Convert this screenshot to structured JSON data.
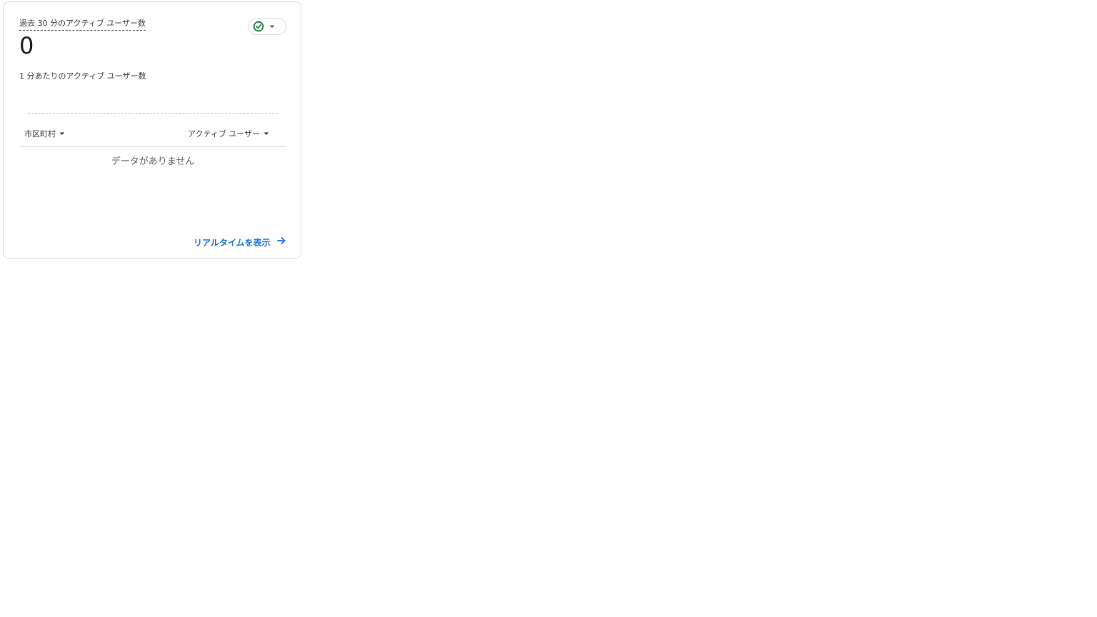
{
  "card": {
    "title": "過去 30 分のアクティブ ユーザー数",
    "value": "0",
    "subtitle": "1 分あたりのアクティブ ユーザー数",
    "status_icon": "check-circle-icon",
    "status_color": "#188038",
    "table": {
      "columns": [
        "市区町村",
        "アクティブ ユーザー"
      ],
      "empty_message": "データがありません"
    },
    "footer_link": "リアルタイムを表示",
    "link_color": "#1a73e8"
  }
}
